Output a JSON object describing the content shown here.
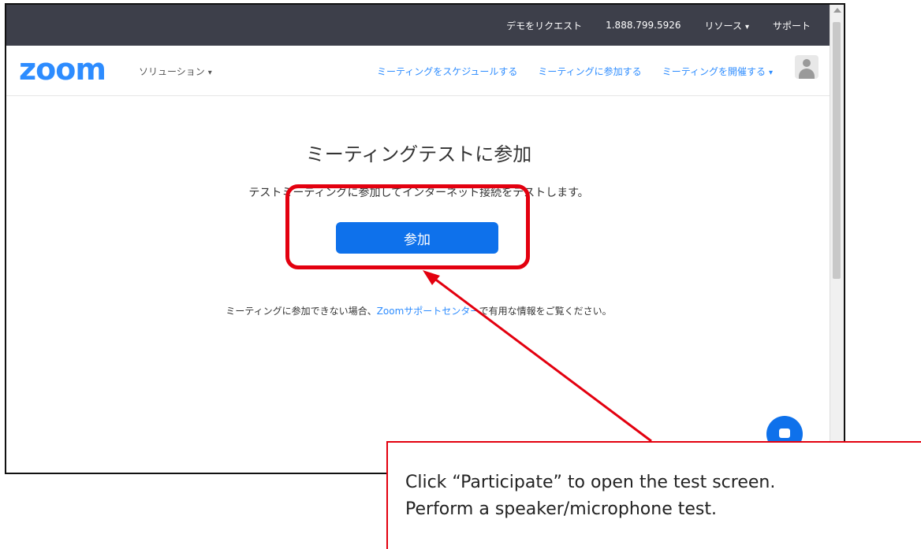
{
  "topbar": {
    "request_demo": "デモをリクエスト",
    "phone": "1.888.799.5926",
    "resources": "リソース",
    "support": "サポート"
  },
  "nav": {
    "logo": "zoom",
    "solutions": "ソリューション",
    "links": [
      "ミーティングをスケジュールする",
      "ミーティングに参加する",
      "ミーティングを開催する"
    ]
  },
  "main": {
    "heading": "ミーティングテストに参加",
    "description": "テストミーティングに参加してインターネット接続をテストします。",
    "join_button": "参加",
    "help_prefix": "ミーティングに参加できない場合、",
    "help_link": "Zoomサポートセンター",
    "help_suffix": "で有用な情報をご覧ください。"
  },
  "annotation": {
    "line1": "Click “Participate” to open the test screen.",
    "line2": "Perform a speaker/microphone test.",
    "accent_color": "#e3000f"
  },
  "colors": {
    "brand": "#2d8cff",
    "button": "#0e71eb",
    "topbar": "#3d3f4a"
  }
}
